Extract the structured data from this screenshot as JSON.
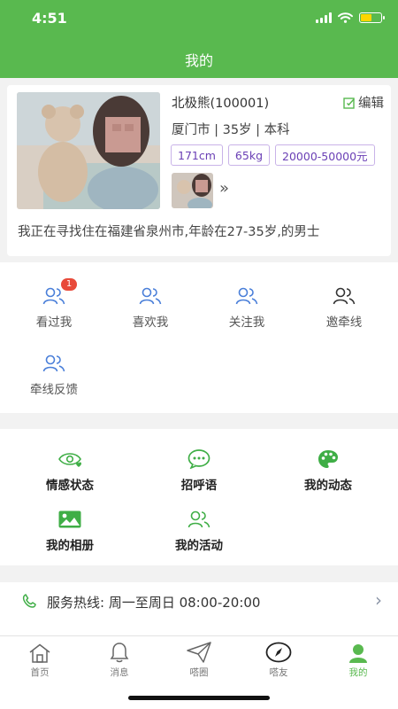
{
  "status_bar": {
    "time": "4:51"
  },
  "nav": {
    "title": "我的"
  },
  "profile": {
    "name": "北极熊(100001)",
    "edit_label": "编辑",
    "location": "厦门市",
    "age": "35岁",
    "education": "本科",
    "separator": "|",
    "tags": [
      "171cm",
      "65kg",
      "20000-50000元"
    ],
    "intro": "我正在寻找住在福建省泉州市,年龄在27-35岁,的男士",
    "more_symbol": "»"
  },
  "interactions": [
    {
      "label": "看过我",
      "icon": "users-icon",
      "badge": "1"
    },
    {
      "label": "喜欢我",
      "icon": "users-icon"
    },
    {
      "label": "关注我",
      "icon": "users-icon"
    },
    {
      "label": "邀牵线",
      "icon": "users-icon"
    },
    {
      "label": "牵线反馈",
      "icon": "users-icon"
    }
  ],
  "features": [
    {
      "label": "情感状态",
      "icon": "eye-heart-icon"
    },
    {
      "label": "招呼语",
      "icon": "chat-bubble-icon"
    },
    {
      "label": "我的动态",
      "icon": "palette-icon"
    },
    {
      "label": "我的相册",
      "icon": "image-icon"
    },
    {
      "label": "我的活动",
      "icon": "users-icon"
    }
  ],
  "hotline": {
    "text": "服务热线: 周一至周日 08:00-20:00"
  },
  "tabbar": [
    {
      "label": "首页",
      "icon": "home-icon"
    },
    {
      "label": "消息",
      "icon": "bell-icon"
    },
    {
      "label": "嗒圈",
      "icon": "paper-plane-icon"
    },
    {
      "label": "嗒友",
      "icon": "compass-icon"
    },
    {
      "label": "我的",
      "icon": "person-icon",
      "active": true
    }
  ],
  "colors": {
    "brand_green": "#59b94f",
    "tag_purple": "#6a3fb5",
    "badge_red": "#e84a3a",
    "icon_blue": "#4a7fd9"
  }
}
